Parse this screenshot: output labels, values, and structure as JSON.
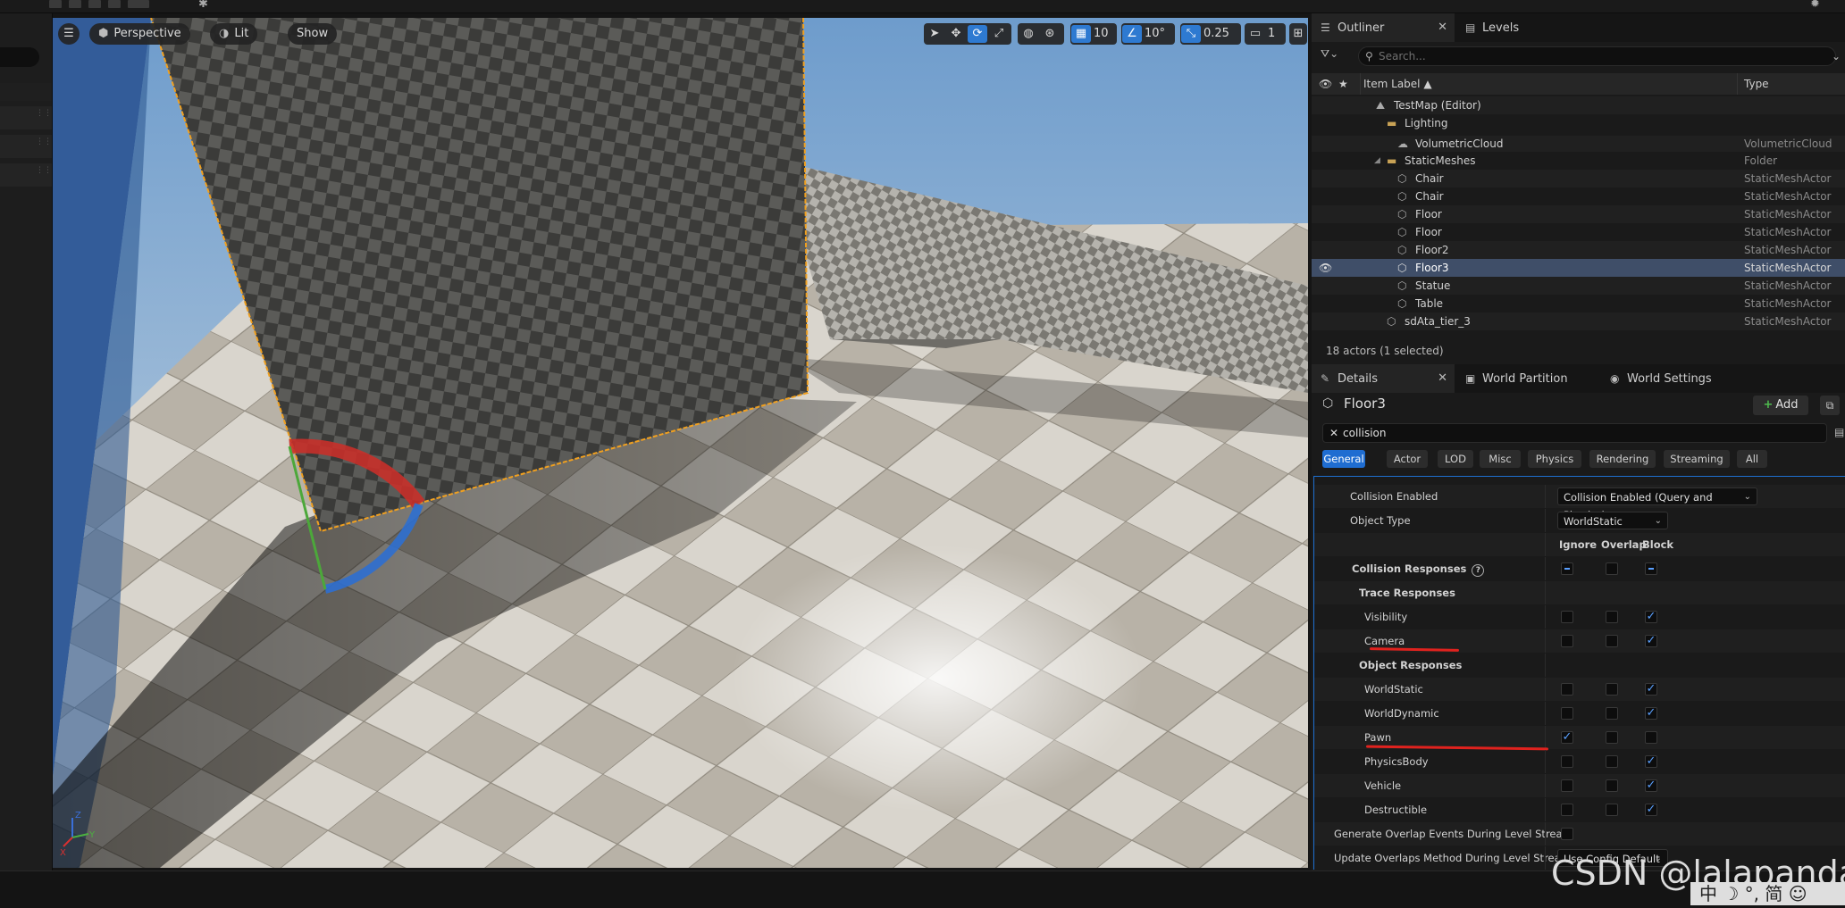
{
  "viewport": {
    "perspective_label": "Perspective",
    "lit_label": "Lit",
    "show_label": "Show",
    "grid_snap_value": "10",
    "rotation_snap_value": "10°",
    "scale_snap_value": "0.25",
    "camera_speed_value": "1",
    "axis_labels": {
      "z": "Z",
      "y": "Y",
      "x": "X"
    }
  },
  "outliner": {
    "tab_label": "Outliner",
    "levels_tab_label": "Levels",
    "search_placeholder": "Search...",
    "col_item_label": "Item Label ▲",
    "col_type": "Type",
    "rows": [
      {
        "label": "TestMap (Editor)",
        "type": "",
        "icon": "map-icon"
      },
      {
        "label": "Lighting",
        "type": "",
        "icon": "folder-icon"
      },
      {
        "label": "VolumetricCloud",
        "type": "VolumetricCloud",
        "icon": "cloud-icon"
      },
      {
        "label": "StaticMeshes",
        "type": "Folder",
        "icon": "folder-icon"
      },
      {
        "label": "Chair",
        "type": "StaticMeshActor",
        "icon": "mesh-icon"
      },
      {
        "label": "Chair",
        "type": "StaticMeshActor",
        "icon": "mesh-icon"
      },
      {
        "label": "Floor",
        "type": "StaticMeshActor",
        "icon": "mesh-icon"
      },
      {
        "label": "Floor",
        "type": "StaticMeshActor",
        "icon": "mesh-icon"
      },
      {
        "label": "Floor2",
        "type": "StaticMeshActor",
        "icon": "mesh-icon"
      },
      {
        "label": "Floor3",
        "type": "StaticMeshActor",
        "icon": "mesh-icon",
        "selected": true
      },
      {
        "label": "Statue",
        "type": "StaticMeshActor",
        "icon": "mesh-icon"
      },
      {
        "label": "Table",
        "type": "StaticMeshActor",
        "icon": "mesh-icon"
      },
      {
        "label": "sdAta_tier_3",
        "type": "StaticMeshActor",
        "icon": "mesh-icon"
      }
    ],
    "footer": "18 actors (1 selected)"
  },
  "details": {
    "tab_label": "Details",
    "world_partition_tab": "World Partition",
    "world_settings_tab": "World Settings",
    "actor_name": "Floor3",
    "add_label": "Add",
    "search_value": "collision",
    "categories": [
      "General",
      "Actor",
      "LOD",
      "Misc",
      "Physics",
      "Rendering",
      "Streaming",
      "All"
    ],
    "active_category": "General",
    "collision_enabled_label": "Collision Enabled",
    "collision_enabled_value": "Collision Enabled (Query and Physics)",
    "object_type_label": "Object Type",
    "object_type_value": "WorldStatic",
    "col_ignore": "Ignore",
    "col_overlap": "Overlap",
    "col_block": "Block",
    "collision_responses_label": "Collision Responses",
    "trace_responses_label": "Trace Responses",
    "object_responses_label": "Object Responses",
    "responses": [
      {
        "label": "Visibility",
        "ignore": false,
        "overlap": false,
        "block": true
      },
      {
        "label": "Camera",
        "ignore": false,
        "overlap": false,
        "block": true
      },
      {
        "label": "WorldStatic",
        "ignore": false,
        "overlap": false,
        "block": true
      },
      {
        "label": "WorldDynamic",
        "ignore": false,
        "overlap": false,
        "block": true
      },
      {
        "label": "Pawn",
        "ignore": true,
        "overlap": false,
        "block": false
      },
      {
        "label": "PhysicsBody",
        "ignore": false,
        "overlap": false,
        "block": true
      },
      {
        "label": "Vehicle",
        "ignore": false,
        "overlap": false,
        "block": true
      },
      {
        "label": "Destructible",
        "ignore": false,
        "overlap": false,
        "block": true
      }
    ],
    "generate_overlap_label": "Generate Overlap Events During Level Strea...",
    "generate_overlap_checked": false,
    "update_overlaps_label": "Update Overlaps Method During Level Strea...",
    "update_overlaps_value": "Use Config Default"
  },
  "watermark": "CSDN @lalapanda",
  "ime_text": "中 ☽ °, 简 ☺",
  "colors": {
    "accent": "#1f6dd1",
    "selection_row": "#3f4e68",
    "check": "#5aa0ff",
    "annotation_red": "#e0221e",
    "selection_outline": "#f0a020"
  }
}
